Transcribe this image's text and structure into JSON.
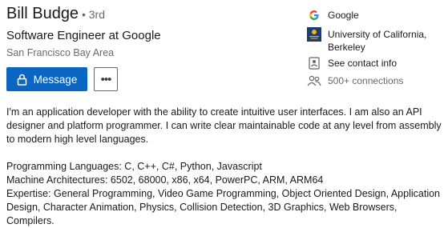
{
  "profile": {
    "name": "Bill Budge",
    "degree": " • 3rd",
    "headline": "Software Engineer at Google",
    "location": "San Francisco Bay Area"
  },
  "actions": {
    "message_label": "Message",
    "more_label": "•••"
  },
  "sidebar": {
    "company": "Google",
    "education_line1": "University of California,",
    "education_line2": "Berkeley",
    "contact": "See contact info",
    "connections": "500+ connections"
  },
  "about": {
    "paragraph1": "I'm an application developer with the ability to create intuitive user interfaces. I am also an API designer and platform programmer. I can write clear maintainable code at any level from assembly to modern high level languages.",
    "lines": [
      "Programming Languages: C, C++, C#, Python, Javascript",
      "Machine Architectures: 6502, 68000, x86, x64, PowerPC, ARM, ARM64",
      "Expertise: General Programming, Video Game Programming, Object Oriented Design, Application Design, Character Animation, Physics, Collision Detection, 3D Graphics, Web Browsers, Compilers."
    ]
  },
  "colors": {
    "primary_blue": "#0a66c2",
    "berkeley_navy": "#1f3d6b",
    "berkeley_gold": "#f0b323"
  },
  "icons": [
    "lock-icon",
    "google-logo-icon",
    "berkeley-logo-icon",
    "contact-card-icon",
    "connections-icon"
  ]
}
